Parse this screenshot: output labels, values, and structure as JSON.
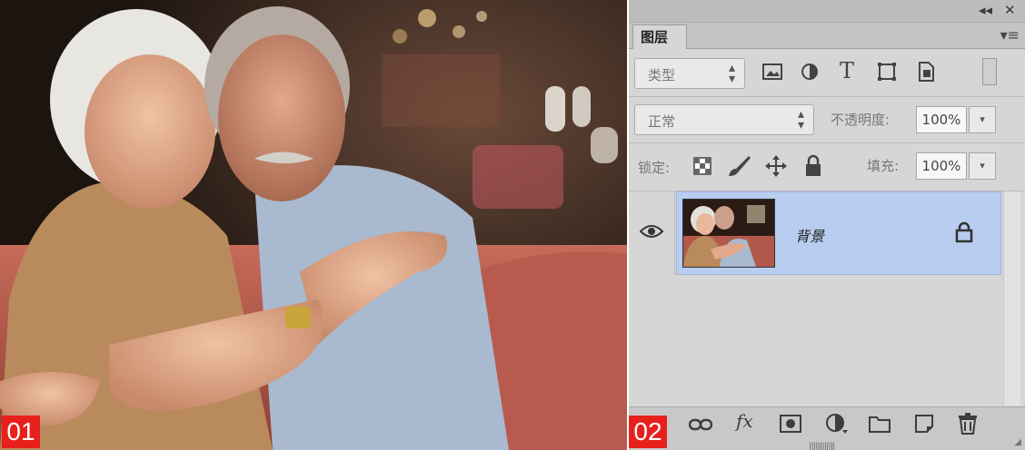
{
  "badges": {
    "left": "01",
    "right": "02"
  },
  "panel": {
    "top_buttons": {
      "collapse": "◂◂",
      "close": "✕"
    },
    "tab_label": "图层",
    "menu_icon": "panel-menu-icon",
    "filter": {
      "select_value": "类型",
      "icons": [
        "image-filter-icon",
        "adjustment-filter-icon",
        "type-filter-icon",
        "shape-filter-icon",
        "smart-object-filter-icon"
      ]
    },
    "blend": {
      "mode": "正常",
      "opacity_label": "不透明度:",
      "opacity_value": "100%"
    },
    "lock": {
      "label": "锁定:",
      "fill_label": "填充:",
      "fill_value": "100%",
      "icons": [
        "lock-transparency-icon",
        "lock-paint-icon",
        "lock-position-icon",
        "lock-all-icon"
      ]
    },
    "layers": [
      {
        "name": "背景",
        "visible": true,
        "locked": true,
        "selected": true
      }
    ],
    "bottom_icons": [
      "link-layers-icon",
      "fx-icon",
      "add-mask-icon",
      "adjustment-layer-icon",
      "new-group-icon",
      "new-layer-icon",
      "delete-layer-icon"
    ]
  },
  "colors": {
    "badge": "#e8201c",
    "selection": "#b8cdf0"
  }
}
